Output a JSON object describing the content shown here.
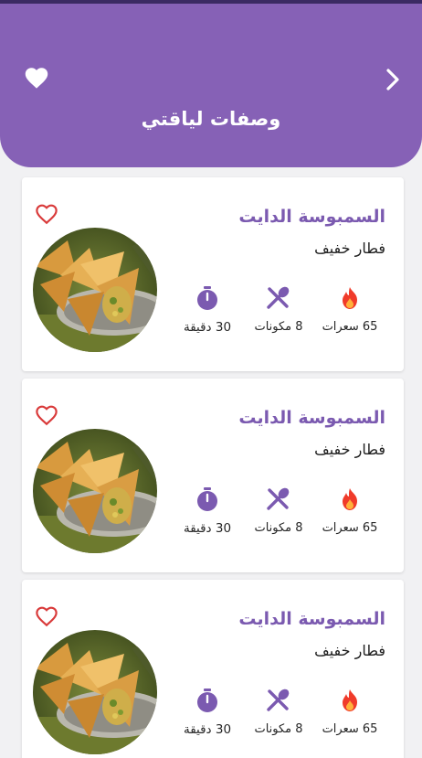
{
  "header": {
    "title": "وصفات لياقتي",
    "back_icon": "chevron-right-icon",
    "favorite_icon": "heart-icon",
    "background": "#8661b6"
  },
  "recipes": [
    {
      "name": "السمبوسة الدايت",
      "category": "فطار خفيف",
      "calories": "65 سعرات",
      "ingredients": "8 مكونات",
      "time": "30 دقيقة",
      "favorited": false
    },
    {
      "name": "السمبوسة الدايت",
      "category": "فطار خفيف",
      "calories": "65 سعرات",
      "ingredients": "8 مكونات",
      "time": "30 دقيقة",
      "favorited": false
    },
    {
      "name": "السمبوسة الدايت",
      "category": "فطار خفيف",
      "calories": "65 سعرات",
      "ingredients": "8 مكونات",
      "time": "30 دقيقة",
      "favorited": false
    }
  ],
  "colors": {
    "accent": "#7b5ab0",
    "icon": "#7b5ab0",
    "fire": "#f03b2a",
    "heart_outline": "#d93a3a"
  }
}
